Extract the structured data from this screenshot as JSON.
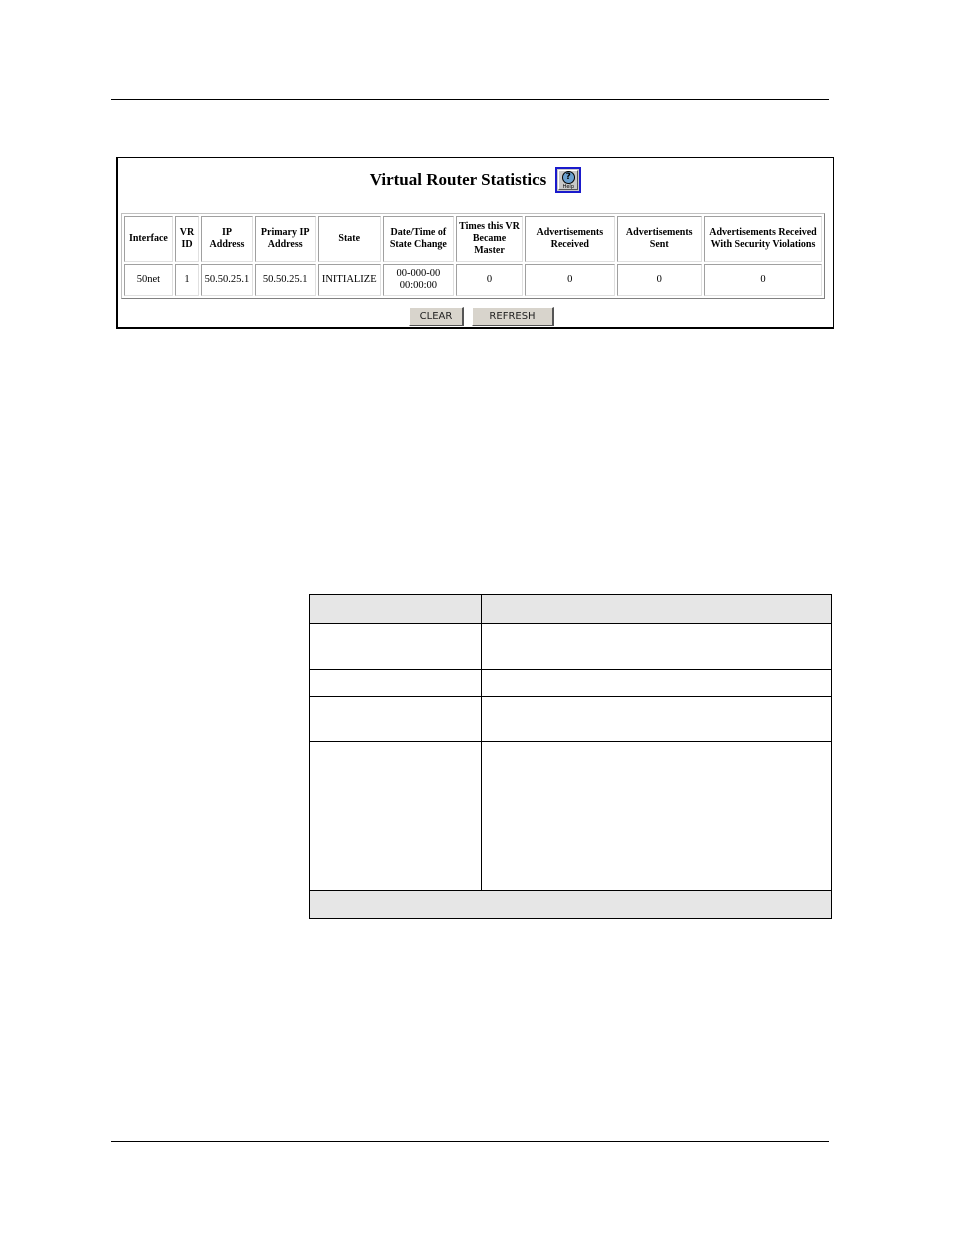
{
  "page": {
    "header_rule": true,
    "footer_rule": true
  },
  "figure": {
    "title": "Virtual Router Statistics",
    "help_button": {
      "label": "Help",
      "icon": "question-mark-icon"
    },
    "stats_table": {
      "columns": [
        "Interface",
        "VR ID",
        "IP Address",
        "Primary IP Address",
        "State",
        "Date/Time of State Change",
        "Times this VR Became Master",
        "Advertisements Received",
        "Advertisements Sent",
        "Advertisements Received With Security Violations"
      ],
      "rows": [
        [
          "50net",
          "1",
          "50.50.25.1",
          "50.50.25.1",
          "INITIALIZE",
          "00-000-00 00:00:00",
          "0",
          "0",
          "0",
          "0"
        ]
      ]
    },
    "buttons": {
      "clear": "CLEAR",
      "refresh": "REFRESH"
    }
  },
  "doc_table": {
    "header": [
      "",
      ""
    ],
    "rows": [
      [
        "",
        ""
      ],
      [
        "",
        ""
      ],
      [
        "",
        ""
      ],
      [
        "",
        ""
      ]
    ],
    "footer": ""
  }
}
